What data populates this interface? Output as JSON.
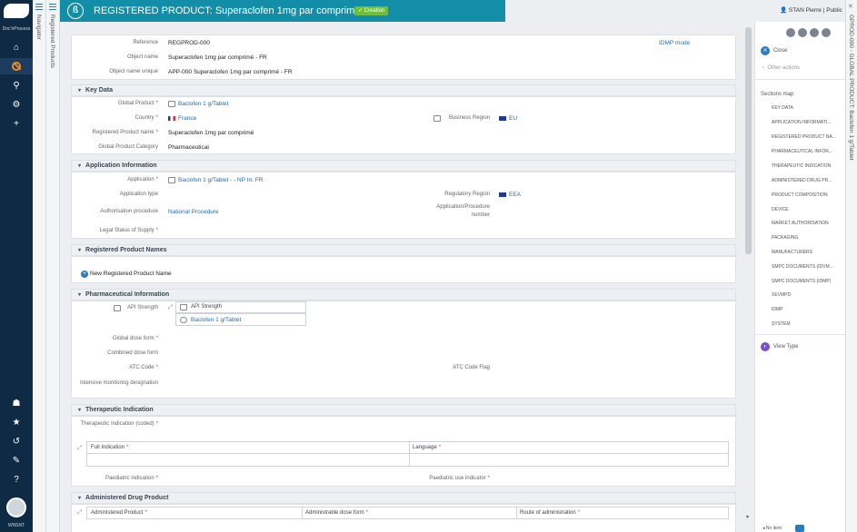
{
  "rail": {
    "logo_text": "Doc'nProcess",
    "user": "WNSNT"
  },
  "panels": {
    "navigator": "Navigator",
    "registered_products": "Registered Products"
  },
  "header": {
    "title": "REGISTERED PRODUCT: Superaclofen 1mg par comprimé - FR",
    "status": "Creation",
    "user": "STAN Pierre",
    "visibility": "Public"
  },
  "top": {
    "reference_label": "Reference",
    "reference": "REGPROD-000",
    "object_name_label": "Object name",
    "object_name": "Superaclofen 1mg par comprimé - FR",
    "object_name_unique_label": "Object name unique",
    "object_name_unique": "APP-000 Superaclofen 1mg par comprimé - FR",
    "idmp_mode": "IDMP mode"
  },
  "key_data": {
    "title": "Key Data",
    "global_product_label": "Global Product",
    "global_product": "Baclofen 1 g/Tablet",
    "country_label": "Country",
    "country": "France",
    "business_region_label": "Business Region",
    "business_region": "EU",
    "registered_name_label": "Registered Product name",
    "registered_name": "Superaclofen 1mg par comprimé",
    "category_label": "Global Product Category",
    "category": "Pharmaceutical"
  },
  "application": {
    "title": "Application Information",
    "application_label": "Application",
    "application": "Baclofen 1 g/Tablet - - NP In: FR",
    "application_type_label": "Application type",
    "regulatory_region_label": "Regulatory Region",
    "regulatory_region": "EEA",
    "procedure_label": "Authorisation procedure",
    "procedure": "National Procedure",
    "app_number_label": "Application/Procedure number",
    "legal_status_label": "Legal Status of Supply"
  },
  "names": {
    "title": "Registered Product Names",
    "new_label": "New Registered Product Name"
  },
  "pharma": {
    "title": "Pharmaceutical Information",
    "api_strength_label": "API Strength",
    "api_strength_col": "API Strength",
    "api_strength_value": "Baclofen 1 g/Tablet",
    "global_dose_label": "Global dose form",
    "combined_dose_label": "Combined dose form",
    "atc_label": "ATC Code",
    "atc_flag_label": "ATC Code Flag",
    "monitoring_label": "Intensive monitoring designation"
  },
  "therapeutic": {
    "title": "Therapeutic Indication",
    "coded_label": "Therapeutic Indication (coded)",
    "full_col": "Full Indication",
    "language_col": "Language",
    "paediatric_label": "Paediatric indication",
    "paediatric_use_label": "Paediatric use indicator"
  },
  "administered": {
    "title": "Administered Drug Product",
    "col1": "Administered Product",
    "col2": "Administrable dose form",
    "col3": "Route of administration"
  },
  "right_panel": {
    "close": "Close",
    "other_actions": "Other actions",
    "sections_map": "Sections map",
    "sections": [
      "KEY DATA",
      "APPLICATION INFORMATI...",
      "REGISTERED PRODUCT NA...",
      "PHARMACEUTICAL INFOR...",
      "THERAPEUTIC INDICATION",
      "ADMINISTERED DRUG PR...",
      "PRODUCT COMPOSITION",
      "DEVICE",
      "MARKET AUTHORISATION",
      "PACKAGING",
      "MANUFACTURERS",
      "SMPC DOCUMENTS (IDVM...",
      "SMPC DOCUMENTS (IDMP)",
      "XEVMPD",
      "IDMP",
      "SYSTEM"
    ],
    "view_type": "View Type",
    "no_item": "No item"
  },
  "edge_text": "GPROD-000 - GLOBAL PRODUCT: Baclofen 1 g/Tablet",
  "colors": {
    "header": "#138ea8",
    "rail": "#0f2a44",
    "link": "#1f6cbf",
    "required": "#e03b3b",
    "badge": "#6fbf3b"
  }
}
